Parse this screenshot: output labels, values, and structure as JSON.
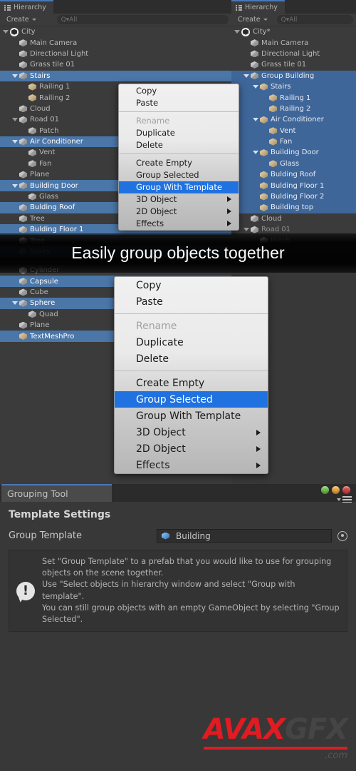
{
  "left_panel": {
    "tab_label": "Hierarchy",
    "create_label": "Create",
    "search_placeholder": "Q▾All",
    "rows": [
      {
        "label": "City",
        "indent": 0,
        "arrow": "open",
        "icon": "unity",
        "state": "normal"
      },
      {
        "label": "Main Camera",
        "indent": 1,
        "arrow": "none",
        "icon": "cube",
        "state": "normal"
      },
      {
        "label": "Directional Light",
        "indent": 1,
        "arrow": "none",
        "icon": "cube",
        "state": "normal"
      },
      {
        "label": "Grass tile 01",
        "indent": 1,
        "arrow": "none",
        "icon": "cube",
        "state": "normal"
      },
      {
        "label": "Stairs",
        "indent": 1,
        "arrow": "open",
        "icon": "cube",
        "state": "selected"
      },
      {
        "label": "Railing 1",
        "indent": 2,
        "arrow": "none",
        "icon": "gold",
        "state": "normal"
      },
      {
        "label": "Railing 2",
        "indent": 2,
        "arrow": "none",
        "icon": "gold",
        "state": "normal"
      },
      {
        "label": "Cloud",
        "indent": 1,
        "arrow": "none",
        "icon": "cube",
        "state": "normal"
      },
      {
        "label": "Road 01",
        "indent": 1,
        "arrow": "open",
        "icon": "cube",
        "state": "normal"
      },
      {
        "label": "Patch",
        "indent": 2,
        "arrow": "none",
        "icon": "cube",
        "state": "normal"
      },
      {
        "label": "Air Conditioner",
        "indent": 1,
        "arrow": "open",
        "icon": "cube",
        "state": "selected"
      },
      {
        "label": "Vent",
        "indent": 2,
        "arrow": "none",
        "icon": "cube",
        "state": "normal"
      },
      {
        "label": "Fan",
        "indent": 2,
        "arrow": "none",
        "icon": "cube",
        "state": "normal"
      },
      {
        "label": "Plane",
        "indent": 1,
        "arrow": "none",
        "icon": "cube",
        "state": "normal"
      },
      {
        "label": "Building Door",
        "indent": 1,
        "arrow": "open",
        "icon": "cube",
        "state": "selected"
      },
      {
        "label": "Glass",
        "indent": 2,
        "arrow": "none",
        "icon": "cube",
        "state": "normal"
      },
      {
        "label": "Bulding Roof",
        "indent": 1,
        "arrow": "none",
        "icon": "cube",
        "state": "selected"
      },
      {
        "label": "Tree",
        "indent": 1,
        "arrow": "none",
        "icon": "cube",
        "state": "normal"
      },
      {
        "label": "Bulding Floor 1",
        "indent": 1,
        "arrow": "none",
        "icon": "cube",
        "state": "selected"
      },
      {
        "label": "Tree",
        "indent": 1,
        "arrow": "none",
        "icon": "cube",
        "state": "normal"
      },
      {
        "label": "Stairs",
        "indent": 1,
        "arrow": "none",
        "icon": "cube",
        "state": "selected"
      }
    ],
    "rows_lower": [
      {
        "label": "Cylinder",
        "indent": 1,
        "arrow": "none",
        "icon": "cube",
        "state": "normal"
      },
      {
        "label": "Capsule",
        "indent": 1,
        "arrow": "none",
        "icon": "cube",
        "state": "selected"
      },
      {
        "label": "Cube",
        "indent": 1,
        "arrow": "none",
        "icon": "cube",
        "state": "normal"
      },
      {
        "label": "Sphere",
        "indent": 1,
        "arrow": "open",
        "icon": "cube",
        "state": "selected"
      },
      {
        "label": "Quad",
        "indent": 2,
        "arrow": "none",
        "icon": "cube",
        "state": "normal"
      },
      {
        "label": "Plane",
        "indent": 1,
        "arrow": "none",
        "icon": "cube",
        "state": "normal"
      },
      {
        "label": "TextMeshPro",
        "indent": 1,
        "arrow": "none",
        "icon": "gold",
        "state": "selected"
      }
    ]
  },
  "right_panel": {
    "tab_label": "Hierarchy",
    "create_label": "Create",
    "search_placeholder": "Q▾All",
    "rows": [
      {
        "label": "City*",
        "indent": 0,
        "arrow": "open",
        "icon": "unity",
        "state": "normal"
      },
      {
        "label": "Main Camera",
        "indent": 1,
        "arrow": "none",
        "icon": "cube",
        "state": "normal"
      },
      {
        "label": "Directional Light",
        "indent": 1,
        "arrow": "none",
        "icon": "cube",
        "state": "normal"
      },
      {
        "label": "Grass tile 01",
        "indent": 1,
        "arrow": "none",
        "icon": "cube",
        "state": "normal"
      },
      {
        "label": "Group Building",
        "indent": 1,
        "arrow": "open",
        "icon": "cube",
        "state": "selected"
      },
      {
        "label": "Stairs",
        "indent": 2,
        "arrow": "open",
        "icon": "gold",
        "state": "selected"
      },
      {
        "label": "Railing 1",
        "indent": 3,
        "arrow": "none",
        "icon": "gold",
        "state": "selected"
      },
      {
        "label": "Railing 2",
        "indent": 3,
        "arrow": "none",
        "icon": "gold",
        "state": "selected"
      },
      {
        "label": "Air Conditioner",
        "indent": 2,
        "arrow": "open",
        "icon": "gold",
        "state": "selected"
      },
      {
        "label": "Vent",
        "indent": 3,
        "arrow": "none",
        "icon": "gold",
        "state": "selected"
      },
      {
        "label": "Fan",
        "indent": 3,
        "arrow": "none",
        "icon": "gold",
        "state": "selected"
      },
      {
        "label": "Building Door",
        "indent": 2,
        "arrow": "open",
        "icon": "gold",
        "state": "selected"
      },
      {
        "label": "Glass",
        "indent": 3,
        "arrow": "none",
        "icon": "gold",
        "state": "selected"
      },
      {
        "label": "Bulding Roof",
        "indent": 2,
        "arrow": "none",
        "icon": "gold",
        "state": "selected"
      },
      {
        "label": "Bulding Floor 1",
        "indent": 2,
        "arrow": "none",
        "icon": "gold",
        "state": "selected"
      },
      {
        "label": "Bulding Floor 2",
        "indent": 2,
        "arrow": "none",
        "icon": "gold",
        "state": "selected"
      },
      {
        "label": "Building top",
        "indent": 2,
        "arrow": "none",
        "icon": "gold",
        "state": "selected"
      },
      {
        "label": "Cloud",
        "indent": 1,
        "arrow": "none",
        "icon": "cube",
        "state": "normal"
      },
      {
        "label": "Road 01",
        "indent": 1,
        "arrow": "open",
        "icon": "cube",
        "state": "dim"
      },
      {
        "label": "Patch",
        "indent": 2,
        "arrow": "none",
        "icon": "cube",
        "state": "dim"
      }
    ]
  },
  "context_menu_top": {
    "items": [
      {
        "label": "Copy",
        "state": "normal",
        "submenu": false
      },
      {
        "label": "Paste",
        "state": "normal",
        "submenu": false
      },
      {
        "label": "__sep__",
        "state": "separator",
        "submenu": false
      },
      {
        "label": "Rename",
        "state": "disabled",
        "submenu": false
      },
      {
        "label": "Duplicate",
        "state": "normal",
        "submenu": false
      },
      {
        "label": "Delete",
        "state": "normal",
        "submenu": false
      },
      {
        "label": "__sep__",
        "state": "separator",
        "submenu": false
      },
      {
        "label": "Create Empty",
        "state": "normal",
        "submenu": false
      },
      {
        "label": "Group Selected",
        "state": "normal",
        "submenu": false
      },
      {
        "label": "Group With Template",
        "state": "highlighted",
        "submenu": false
      },
      {
        "label": "3D Object",
        "state": "normal",
        "submenu": true
      },
      {
        "label": "2D Object",
        "state": "normal",
        "submenu": true
      },
      {
        "label": "Effects",
        "state": "normal",
        "submenu": true
      }
    ]
  },
  "context_menu_bottom": {
    "items": [
      {
        "label": "Copy",
        "state": "normal",
        "submenu": false
      },
      {
        "label": "Paste",
        "state": "normal",
        "submenu": false
      },
      {
        "label": "__sep__",
        "state": "separator",
        "submenu": false
      },
      {
        "label": "Rename",
        "state": "disabled",
        "submenu": false
      },
      {
        "label": "Duplicate",
        "state": "normal",
        "submenu": false
      },
      {
        "label": "Delete",
        "state": "normal",
        "submenu": false
      },
      {
        "label": "__sep__",
        "state": "separator",
        "submenu": false
      },
      {
        "label": "Create Empty",
        "state": "normal",
        "submenu": false
      },
      {
        "label": "Group Selected",
        "state": "highlighted",
        "submenu": false
      },
      {
        "label": "Group With Template",
        "state": "normal",
        "submenu": false
      },
      {
        "label": "3D Object",
        "state": "normal",
        "submenu": true
      },
      {
        "label": "2D Object",
        "state": "normal",
        "submenu": true
      },
      {
        "label": "Effects",
        "state": "normal",
        "submenu": true
      }
    ]
  },
  "caption": {
    "text": "Easily group objects together"
  },
  "grouping_tool": {
    "tab_label": "Grouping Tool",
    "section_title": "Template Settings",
    "template_field_label": "Group Template",
    "template_value": "Building",
    "help_text": "Set \"Group Template\" to a prefab that you would like to use for grouping objects on the scene together.\nUse \"Select objects in hierarchy window and select \"Group with template\".\nYou can still group objects with an empty GameObject by selecting \"Group Selected\".",
    "lights": [
      "#6ec04a",
      "#e8a63a",
      "#d94040"
    ]
  },
  "watermark": {
    "avax": "AVAX",
    "gfx": "GFX",
    "com": ".com"
  }
}
